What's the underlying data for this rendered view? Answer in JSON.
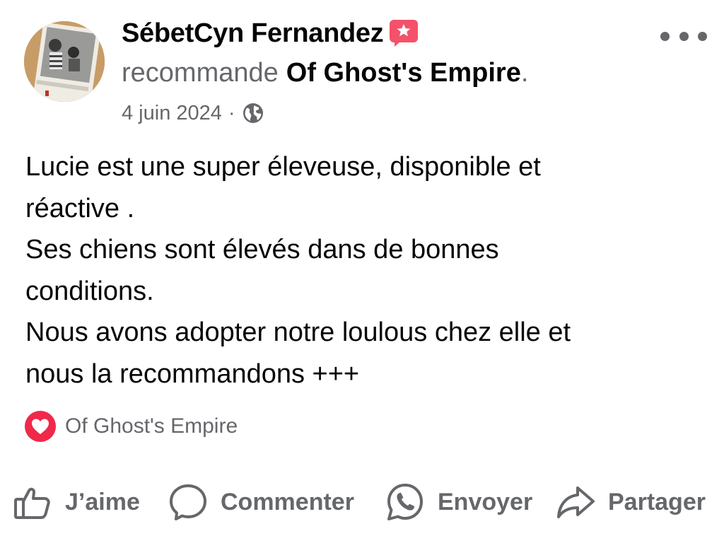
{
  "post": {
    "author_name": "SébetCyn Fernandez",
    "recommend_verb": "recommande",
    "recommended_page": "Of Ghost's Empire",
    "recommend_end": ".",
    "date": "4 juin 2024",
    "meta_separator": "·",
    "privacy_icon": "globe-icon",
    "body_lines": [
      "Lucie est une super éleveuse, disponible et",
      "réactive .",
      "Ses chiens sont élevés dans de bonnes",
      "conditions.",
      "Nous avons adopter notre loulous chez elle et",
      "nous la recommandons +++"
    ],
    "reaction": {
      "icon": "heart-icon",
      "label": "Of Ghost's Empire"
    }
  },
  "actions": [
    {
      "icon": "thumbs-up-icon",
      "label": "J’aime"
    },
    {
      "icon": "comment-bubble-icon",
      "label": "Commenter"
    },
    {
      "icon": "whatsapp-icon",
      "label": "Envoyer"
    },
    {
      "icon": "share-arrow-icon",
      "label": "Partager"
    }
  ],
  "colors": {
    "text_primary": "#050505",
    "text_secondary": "#65676b",
    "heart_red": "#f0284a",
    "badge_pink": "#f3526a"
  }
}
